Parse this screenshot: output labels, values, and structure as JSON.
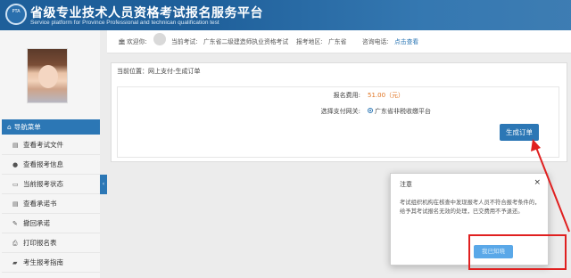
{
  "header": {
    "logo_text": "PTA",
    "title": "省级专业技术人员资格考试报名服务平台",
    "subtitle": "Service platform for Province Professional and technican qualification test"
  },
  "infobar": {
    "welcome": "欢迎你:",
    "exam_label": "当前考试:",
    "exam_value": "广东省二级建造师执业资格考试",
    "region_label": "报考地区:",
    "region_value": "广东省",
    "phone_label": "咨询电话:",
    "phone_link": "点击查看"
  },
  "sidebar": {
    "nav_title": "导航菜单",
    "items": [
      {
        "icon": "file-icon",
        "glyph": "▤",
        "label": "查看考试文件"
      },
      {
        "icon": "info-icon",
        "glyph": "●",
        "label": "查看报考信息"
      },
      {
        "icon": "monitor-icon",
        "glyph": "▭",
        "label": "当前报考状态"
      },
      {
        "icon": "document-icon",
        "glyph": "▤",
        "label": "查看承诺书"
      },
      {
        "icon": "pen-icon",
        "glyph": "✎",
        "label": "撤回承诺"
      },
      {
        "icon": "print-icon",
        "glyph": "⎙",
        "label": "打印报名表"
      },
      {
        "icon": "book-icon",
        "glyph": "▰",
        "label": "考生报考指南"
      }
    ],
    "collapse_glyph": "‹"
  },
  "main": {
    "breadcrumb": "当前位置：网上支付-生成订单",
    "fee_label": "报名费用:",
    "fee_value": "51.00（元）",
    "gateway_label": "选择支付网关:",
    "gateway_option": "广东省非税收缴平台",
    "order_button": "生成订单"
  },
  "modal": {
    "title": "注意",
    "close": "×",
    "body": "考试组织机构在核查中发现报考人员不符合报考条件的，给予其考试报名无效的处理，已交费用不予退还。",
    "ok_button": "我已知晓"
  },
  "colors": {
    "brand": "#1e5f9a",
    "accent": "#2c77b5",
    "annotation": "#e02020",
    "fee": "#e07320"
  }
}
